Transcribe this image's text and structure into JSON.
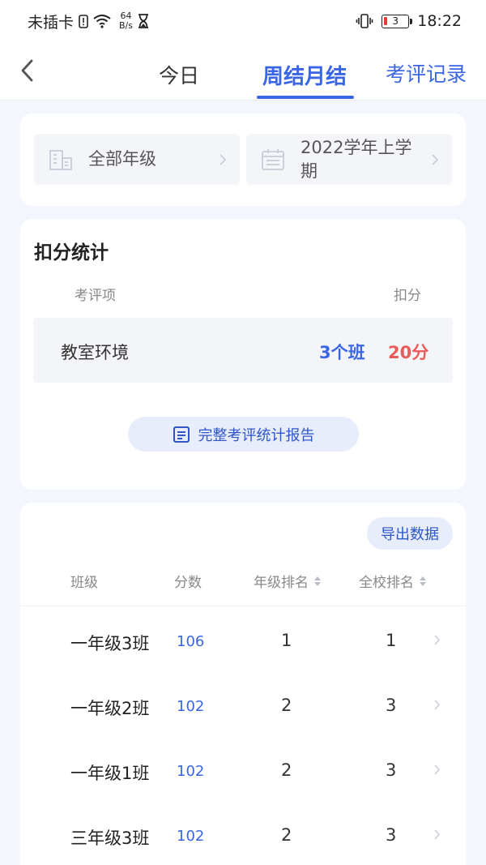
{
  "status_bar": {
    "carrier": "未插卡",
    "speed_value": "64",
    "speed_unit": "B/s",
    "battery_level": "3",
    "time": "18:22"
  },
  "nav": {
    "tabs": [
      {
        "label": "今日"
      },
      {
        "label": "周结月结"
      }
    ],
    "active_tab": "周结月结",
    "record_link": "考评记录"
  },
  "filters": {
    "grade": "全部年级",
    "term": "2022学年上学期"
  },
  "stats": {
    "title": "扣分统计",
    "col_item": "考评项",
    "col_score": "扣分",
    "rows": [
      {
        "name": "教室环境",
        "classes": "3个班",
        "points": "20分"
      }
    ],
    "report_button": "完整考评统计报告"
  },
  "ranking": {
    "export_button": "导出数据",
    "headers": {
      "class": "班级",
      "score": "分数",
      "grade_rank": "年级排名",
      "school_rank": "全校排名"
    },
    "rows": [
      {
        "class": "一年级3班",
        "score": "106",
        "grade_rank": "1",
        "school_rank": "1"
      },
      {
        "class": "一年级2班",
        "score": "102",
        "grade_rank": "2",
        "school_rank": "3"
      },
      {
        "class": "一年级1班",
        "score": "102",
        "grade_rank": "2",
        "school_rank": "3"
      },
      {
        "class": "三年级3班",
        "score": "102",
        "grade_rank": "2",
        "school_rank": "3"
      }
    ]
  },
  "colors": {
    "accent": "#3a66e6",
    "deduction": "#ea5a5a",
    "background": "#f3f6fd"
  },
  "icons": [
    "back-arrow-icon",
    "building-icon",
    "calendar-icon",
    "chevron-right-icon",
    "document-icon",
    "sort-icon",
    "wifi-icon",
    "sim-alert-icon",
    "hourglass-icon",
    "vibrate-icon"
  ]
}
